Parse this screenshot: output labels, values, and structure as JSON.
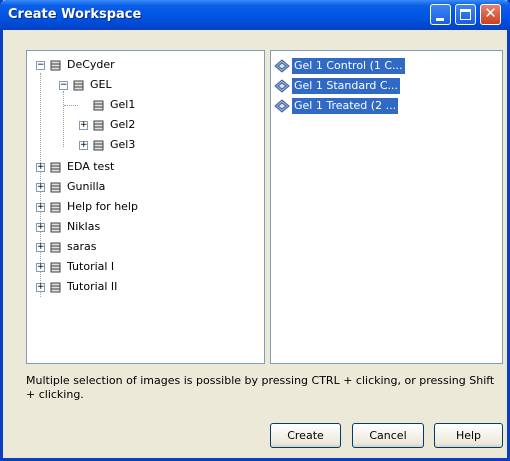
{
  "window": {
    "title": "Create Workspace",
    "buttons": {
      "minimize": "minimize-icon",
      "maximize": "maximize-icon",
      "close": "close-icon"
    }
  },
  "tree": {
    "root": {
      "label": "DeCyder",
      "expander": "−"
    },
    "gel": {
      "label": "GEL",
      "expander": "−"
    },
    "gel_children": [
      {
        "label": "Gel1",
        "expander": ""
      },
      {
        "label": "Gel2",
        "expander": "+"
      },
      {
        "label": "Gel3",
        "expander": "+"
      }
    ],
    "others": [
      {
        "label": "EDA test",
        "expander": "+"
      },
      {
        "label": "Gunilla",
        "expander": "+"
      },
      {
        "label": "Help for help",
        "expander": "+"
      },
      {
        "label": "Niklas",
        "expander": "+"
      },
      {
        "label": "saras",
        "expander": "+"
      },
      {
        "label": "Tutorial I",
        "expander": "+"
      },
      {
        "label": "Tutorial II",
        "expander": "+"
      }
    ]
  },
  "images": [
    {
      "label": "Gel 1 Control (1 C...",
      "selected": true
    },
    {
      "label": "Gel 1 Standard C...",
      "selected": true
    },
    {
      "label": "Gel 1 Treated (2 ...",
      "selected": true
    }
  ],
  "hint": "Multiple selection of images is possible by pressing CTRL + clicking, or pressing Shift + clicking.",
  "actions": {
    "create": "Create",
    "cancel": "Cancel",
    "help": "Help"
  },
  "colors": {
    "titlebar": "#0054e3",
    "selection": "#316ac5",
    "dialog_bg": "#ece9d8"
  }
}
